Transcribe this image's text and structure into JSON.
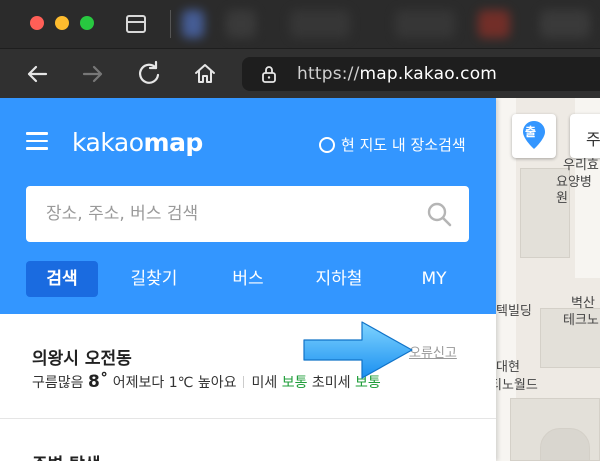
{
  "browser": {
    "url_scheme": "https://",
    "url_host": "map.kakao.com"
  },
  "app": {
    "logo_light": "kakao",
    "logo_bold": "map",
    "current_area_search": "현 지도 내 장소검색",
    "search": {
      "placeholder": "장소, 주소, 버스 검색"
    },
    "tabs": [
      {
        "label": "검색",
        "active": true
      },
      {
        "label": "길찾기"
      },
      {
        "label": "버스"
      },
      {
        "label": "지하철"
      },
      {
        "label": "MY"
      }
    ],
    "location": {
      "name": "의왕시 오전동",
      "report": "오류신고",
      "weather_desc": "구름많음",
      "temperature": "8˚",
      "compare": "어제보다 1℃ 높아요",
      "dust_label": "미세",
      "dust_value": "보통",
      "ultra_dust_label": "초미세",
      "ultra_dust_value": "보통"
    },
    "next_section": "주변 탐색"
  },
  "map": {
    "marker_label": "출",
    "side_button_label": "주",
    "labels": {
      "l1": "우리효",
      "l2": "요양병원",
      "l3": "벽산",
      "l4": "테크노",
      "l5": "텍빌딩",
      "l6": "대현",
      "l7": "티노월드"
    }
  },
  "colors": {
    "kakao_blue": "#3396ff",
    "active_tab": "#1a6be0",
    "good_green": "#1f9e3a"
  }
}
